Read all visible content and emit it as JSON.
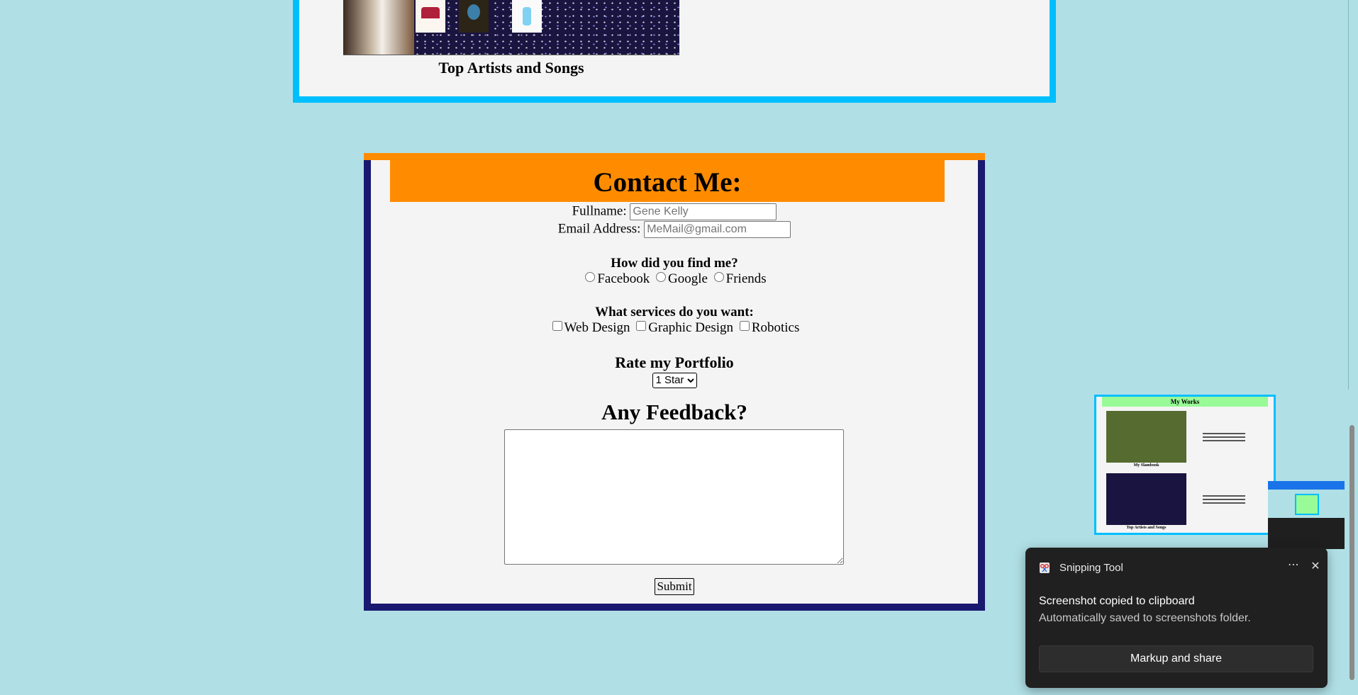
{
  "works": {
    "caption": "Top Artists and Songs"
  },
  "contact": {
    "title": "Contact Me:",
    "fullname_label": "Fullname:",
    "fullname_placeholder": "Gene Kelly",
    "email_label": "Email Address:",
    "email_placeholder": "MeMail@gmail.com",
    "find_question": "How did you find me?",
    "find_options": [
      "Facebook",
      "Google",
      "Friends"
    ],
    "services_question": "What services do you want:",
    "services_options": [
      "Web Design",
      "Graphic Design",
      "Robotics"
    ],
    "rate_title": "Rate my Portfolio",
    "rate_selected": "1 Star",
    "feedback_title": "Any Feedback?",
    "submit_label": "Submit"
  },
  "preview": {
    "title": "My Works",
    "caption_a": "My Slambook",
    "caption_b": "Top Artists and Songs"
  },
  "toast": {
    "app_name": "Snipping Tool",
    "more_icon": "⋯",
    "close_icon": "✕",
    "title": "Screenshot copied to clipboard",
    "subtitle": "Automatically saved to screenshots folder.",
    "action_label": "Markup and share"
  },
  "colors": {
    "page_bg": "#b0e0e6",
    "panel_border_blue": "#00bfff",
    "contact_border": "#191970",
    "contact_header": "#ff8c00",
    "toast_bg": "#202020"
  }
}
